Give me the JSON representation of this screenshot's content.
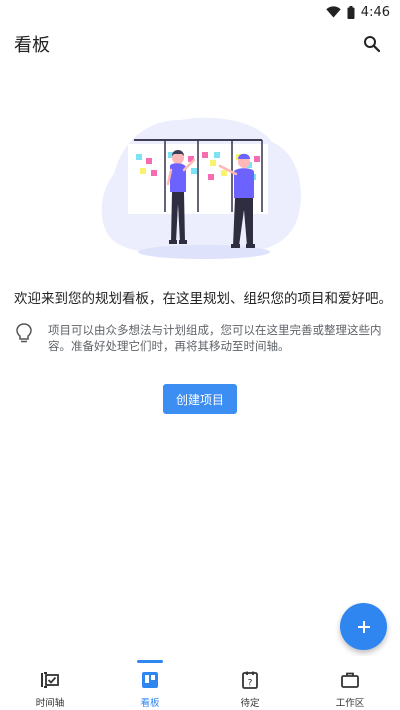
{
  "status_bar": {
    "time": "4:46"
  },
  "app_bar": {
    "title": "看板"
  },
  "main": {
    "welcome": "欢迎来到您的规划看板，在这里规划、组织您的项目和爱好吧。",
    "tip": "项目可以由众多想法与计划组成，您可以在这里完善或整理这些内容。准备好处理它们时，再将其移动至时间轴。",
    "create_button": "创建项目"
  },
  "bottom_nav": {
    "items": [
      {
        "label": "时间轴",
        "icon": "timeline-icon"
      },
      {
        "label": "看板",
        "icon": "board-icon",
        "active": true
      },
      {
        "label": "待定",
        "icon": "pending-icon"
      },
      {
        "label": "工作区",
        "icon": "workspace-icon"
      }
    ]
  },
  "colors": {
    "accent": "#2f86f0",
    "button": "#3d8ef2",
    "illustration_bg": "#eceefd",
    "figure_purple": "#6c63ff"
  }
}
